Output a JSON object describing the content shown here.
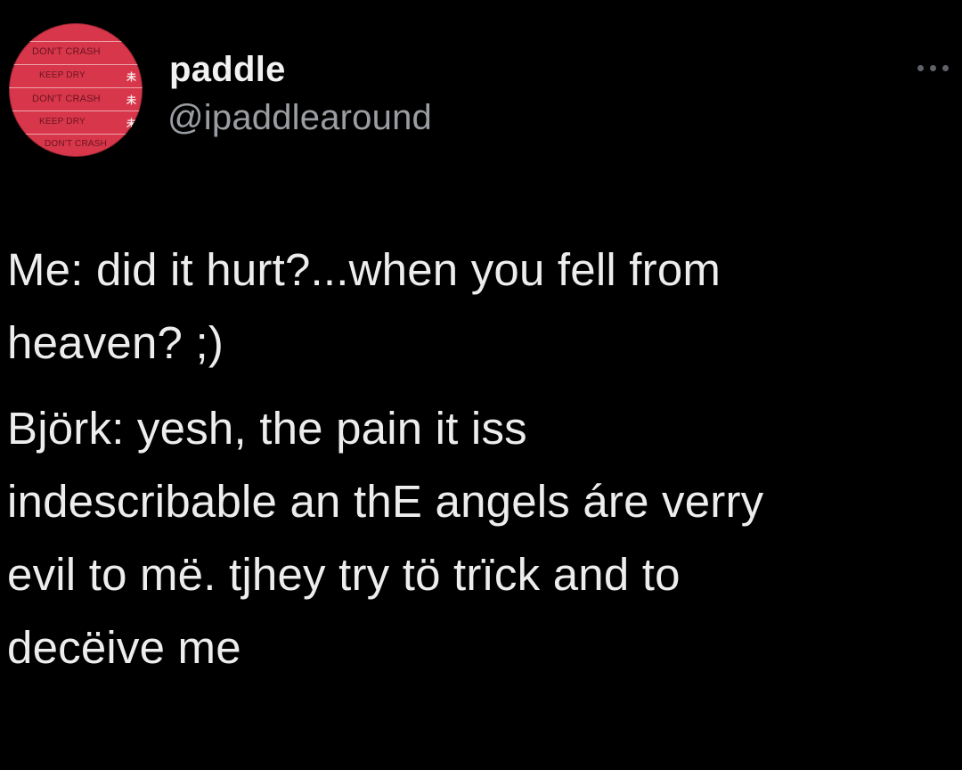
{
  "tweet": {
    "author": {
      "display_name": "paddle",
      "handle": "@ipaddlearound",
      "avatar_icon": "avatar-image",
      "avatar_labels": [
        "DON'T CRASH",
        "KEEP DRY",
        "DON'T CRASH",
        "KEEP DRY",
        "DON'T CRASH"
      ],
      "avatar_glyph": "未",
      "avatar_color": "#d8364a"
    },
    "more_icon": "more-options-icon",
    "paragraphs": [
      "Me: did it hurt?...when you fell from\nheaven? ;)",
      "Björk: yesh, the pain it iss\nindescribable an thE angels áre verry\nevil to më. tjhey try tö trïck and to\ndecëive me"
    ]
  }
}
